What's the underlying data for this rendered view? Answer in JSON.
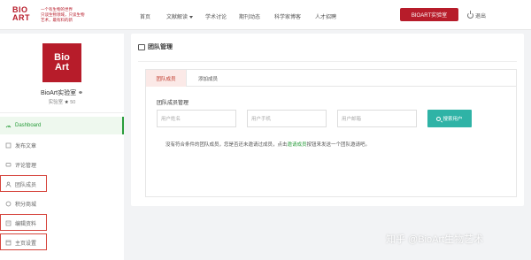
{
  "header": {
    "logo_line1": "BIO",
    "logo_line2": "ART",
    "logo_tagline_1": "一个有生物的世界",
    "logo_tagline_2": "只谈生物领域，只谈生物",
    "logo_tagline_3": "艺术，最有料的新",
    "nav": [
      "首页",
      "文献解读",
      "学术讨论",
      "期刊动态",
      "科学家博客",
      "人才招聘"
    ],
    "lab_button": "BIOART实验室",
    "logout": "退出",
    "accent_color": "#b71c2a"
  },
  "sidebar": {
    "avatar_line1": "Bio",
    "avatar_line2": "Art",
    "profile_name": "BioArt实验室",
    "profile_role": "实验室",
    "profile_score": "50",
    "items": [
      {
        "label": "Dashboard",
        "icon": "dashboard-icon",
        "active": true
      },
      {
        "label": "发布文章",
        "icon": "edit-icon"
      },
      {
        "label": "评论管理",
        "icon": "comment-icon"
      },
      {
        "label": "团队成员",
        "icon": "user-icon"
      },
      {
        "label": "积分商城",
        "icon": "coin-icon"
      },
      {
        "label": "编辑资料",
        "icon": "profile-icon"
      },
      {
        "label": "主页设置",
        "icon": "settings-icon"
      }
    ],
    "active_color": "#2a9d3c"
  },
  "main": {
    "title": "团队管理",
    "tabs": [
      {
        "label": "团队成员",
        "selected": true
      },
      {
        "label": "添加成员",
        "selected": false
      }
    ],
    "section_title": "团队成员管理",
    "inputs": [
      {
        "placeholder": "用户姓名"
      },
      {
        "placeholder": "用户手机"
      },
      {
        "placeholder": "用户邮箱"
      }
    ],
    "search_button": "搜索用户",
    "message_prefix": "没有符合条件的团队成员，您是否还未邀请过成员，点击",
    "message_link": "邀请成员",
    "message_suffix": "按钮来发送一个团队邀请吧。"
  },
  "watermark": "知乎 @BioArt生物艺术"
}
